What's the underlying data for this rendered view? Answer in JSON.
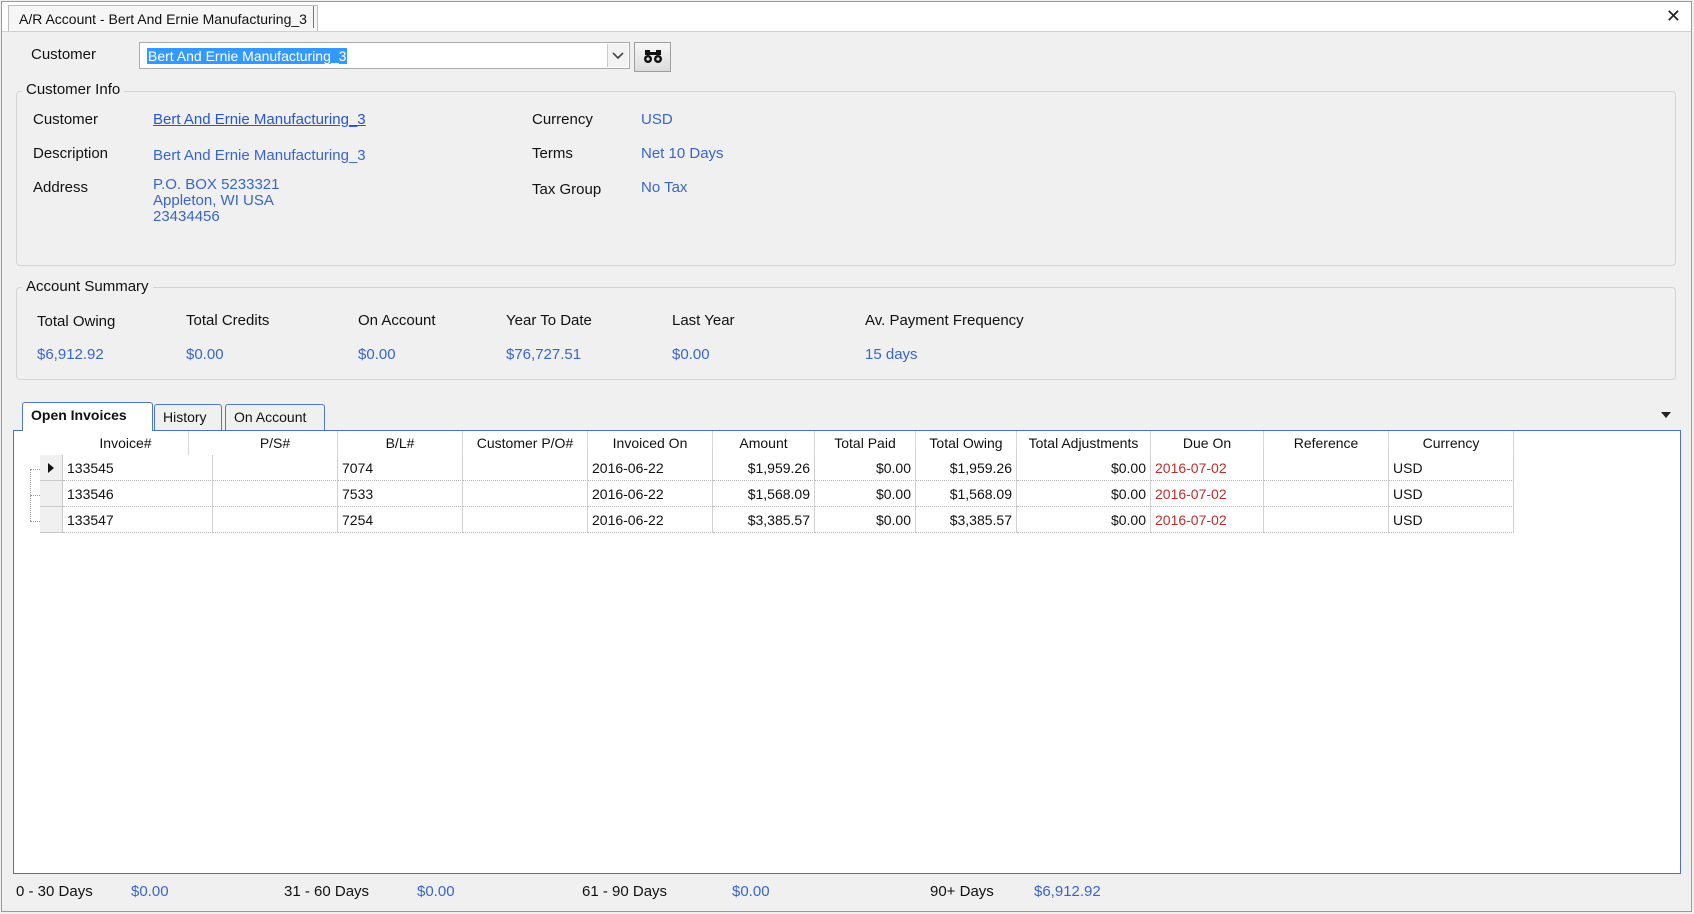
{
  "window": {
    "tab_title": "A/R Account - Bert And Ernie Manufacturing_3",
    "close_glyph": "✕"
  },
  "customer_select": {
    "label": "Customer",
    "value": "Bert And Ernie Manufacturing_3"
  },
  "customer_info": {
    "title": "Customer Info",
    "customer_label": "Customer",
    "customer_value": "Bert And Ernie Manufacturing_3",
    "description_label": "Description",
    "description_value": "Bert And Ernie Manufacturing_3",
    "address_label": "Address",
    "address_line1": "P.O. BOX 5233321",
    "address_line2": "Appleton, WI USA",
    "address_line3": "23434456",
    "currency_label": "Currency",
    "currency_value": "USD",
    "terms_label": "Terms",
    "terms_value": "Net 10 Days",
    "tax_group_label": "Tax Group",
    "tax_group_value": "No Tax"
  },
  "account_summary": {
    "title": "Account Summary",
    "items": [
      {
        "label": "Total Owing",
        "value": "$6,912.92"
      },
      {
        "label": "Total Credits",
        "value": "$0.00"
      },
      {
        "label": "On Account",
        "value": "$0.00"
      },
      {
        "label": "Year To Date",
        "value": "$76,727.51"
      },
      {
        "label": "Last Year",
        "value": "$0.00"
      },
      {
        "label": "Av. Payment Frequency",
        "value": "15 days"
      }
    ]
  },
  "tabs": [
    {
      "label": "Open Invoices",
      "active": true
    },
    {
      "label": "History",
      "active": false
    },
    {
      "label": "On Account",
      "active": false
    }
  ],
  "grid": {
    "columns": [
      "Invoice#",
      "P/S#",
      "B/L#",
      "Customer P/O#",
      "Invoiced On",
      "Amount",
      "Total Paid",
      "Total Owing",
      "Total Adjustments",
      "Due On",
      "Reference",
      "Currency"
    ],
    "rows": [
      [
        "133545",
        "",
        "7074",
        "",
        "2016-06-22",
        "$1,959.26",
        "$0.00",
        "$1,959.26",
        "$0.00",
        "2016-07-02",
        "",
        "USD"
      ],
      [
        "133546",
        "",
        "7533",
        "",
        "2016-06-22",
        "$1,568.09",
        "$0.00",
        "$1,568.09",
        "$0.00",
        "2016-07-02",
        "",
        "USD"
      ],
      [
        "133547",
        "",
        "7254",
        "",
        "2016-06-22",
        "$3,385.57",
        "$0.00",
        "$3,385.57",
        "$0.00",
        "2016-07-02",
        "",
        "USD"
      ]
    ]
  },
  "aging": [
    {
      "label": "0 - 30 Days",
      "value": "$0.00"
    },
    {
      "label": "31 - 60 Days",
      "value": "$0.00"
    },
    {
      "label": "61 - 90 Days",
      "value": "$0.00"
    },
    {
      "label": "90+ Days",
      "value": "$6,912.92"
    }
  ],
  "colors": {
    "value_blue": "#3a65c8",
    "due_red": "#c42b2b",
    "panel_border": "#4a72c4"
  },
  "icons": {
    "dropdown": "chevron-down-icon",
    "find": "binoculars-icon",
    "row_selector": "row-pointer-icon",
    "tab_menu": "triangle-down-icon"
  }
}
